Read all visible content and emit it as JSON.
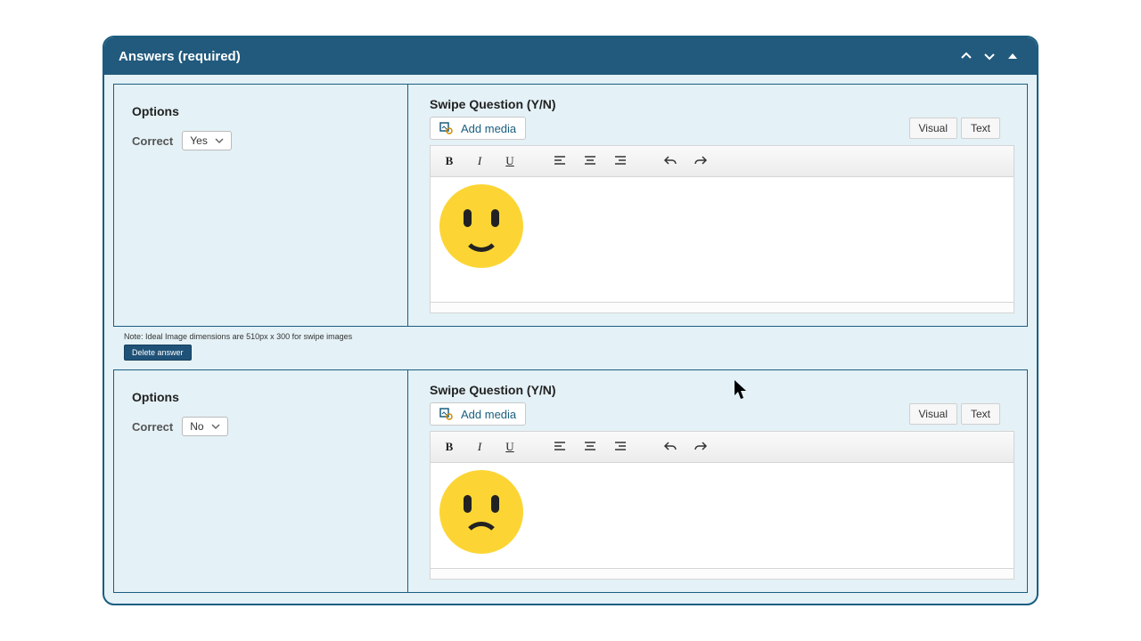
{
  "header": {
    "title": "Answers (required)"
  },
  "answers": [
    {
      "optionsTitle": "Options",
      "correctLabel": "Correct",
      "correctValue": "Yes",
      "sectionTitle": "Swipe Question (Y/N)",
      "addMediaLabel": "Add media",
      "tabs": {
        "visual": "Visual",
        "text": "Text"
      },
      "image": "happy-face"
    },
    {
      "optionsTitle": "Options",
      "correctLabel": "Correct",
      "correctValue": "No",
      "sectionTitle": "Swipe Question (Y/N)",
      "addMediaLabel": "Add media",
      "tabs": {
        "visual": "Visual",
        "text": "Text"
      },
      "image": "sad-face"
    }
  ],
  "note": "Note: Ideal Image dimensions are 510px x 300 for swipe images",
  "deleteLabel": "Delete answer"
}
